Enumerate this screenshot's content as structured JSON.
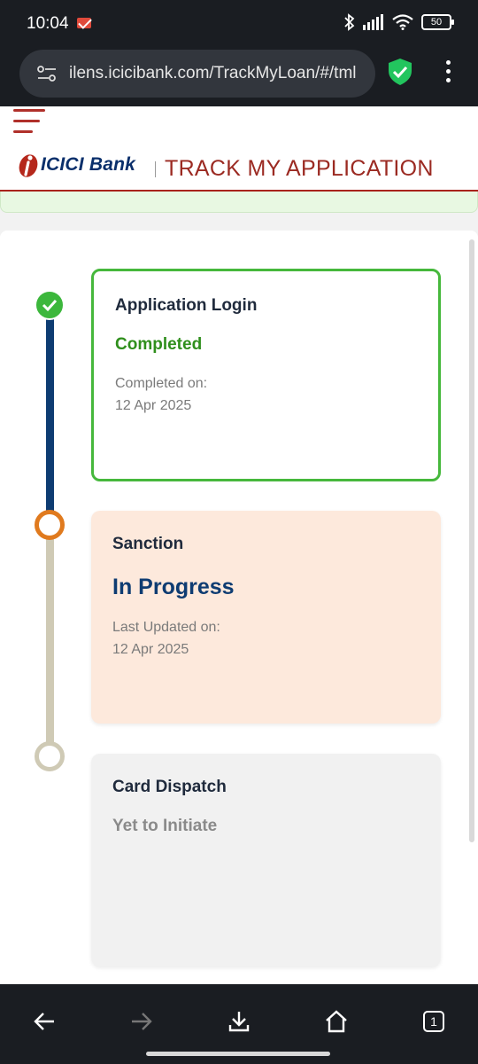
{
  "status_bar": {
    "time": "10:04",
    "battery": "50",
    "icons": [
      "gmail-icon",
      "bluetooth-icon",
      "signal-icon",
      "wifi-icon",
      "battery-icon"
    ]
  },
  "browser": {
    "url": "ilens.icicibank.com/TrackMyLoan/#/tml",
    "icons": [
      "site-settings-icon",
      "shield-check-icon",
      "overflow-menu-icon"
    ]
  },
  "header": {
    "logo_brand": "ICICI",
    "logo_bank": "Bank",
    "title": "TRACK MY APPLICATION"
  },
  "steps": [
    {
      "title": "Application Login",
      "status": "Completed",
      "status_color": "#2f8f1c",
      "meta_label": "Completed on:",
      "meta_date": "12 Apr 2025"
    },
    {
      "title": "Sanction",
      "status": "In Progress",
      "status_color": "#0e3c72",
      "meta_label": "Last Updated on:",
      "meta_date": "12 Apr 2025"
    },
    {
      "title": "Card Dispatch",
      "status": "Yet to Initiate",
      "status_color": "#8a8a8a"
    }
  ],
  "bottom_nav": {
    "tab_count": "1",
    "icons": [
      "back-arrow-icon",
      "forward-arrow-icon",
      "download-icon",
      "home-icon",
      "tab-switcher-icon"
    ]
  },
  "colors": {
    "brand_red": "#9b2a22",
    "brand_blue": "#0a2f6b",
    "complete_green": "#46b83c",
    "progress_orange": "#e07a1e"
  }
}
